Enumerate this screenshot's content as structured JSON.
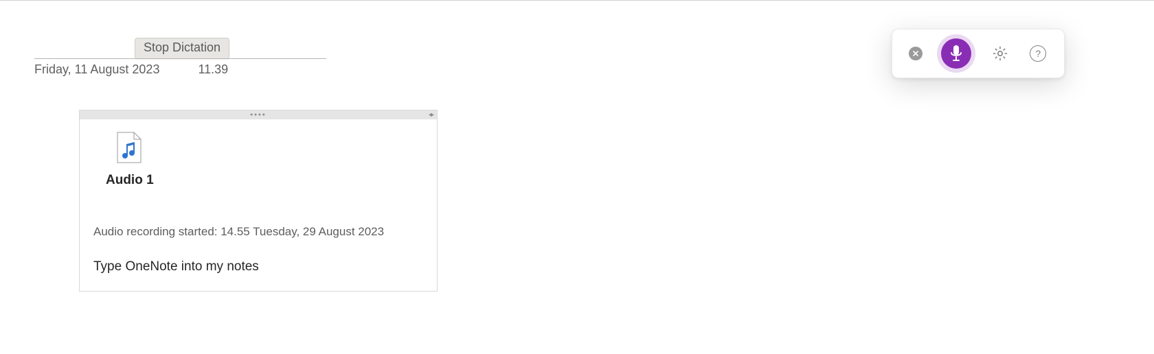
{
  "tooltip": {
    "stop_dictation": "Stop Dictation"
  },
  "header": {
    "date": "Friday, 11 August 2023",
    "time": "11.39"
  },
  "note": {
    "attachment_label": "Audio 1",
    "recording_status": "Audio recording started: 14.55 Tuesday, 29 August 2023",
    "typed_text": "Type OneNote into my notes"
  },
  "toolbar": {
    "close_icon": "close-icon",
    "mic_icon": "microphone-icon",
    "settings_icon": "gear-icon",
    "help_icon": "help-icon",
    "help_glyph": "?"
  },
  "colors": {
    "accent": "#8a2db5"
  }
}
